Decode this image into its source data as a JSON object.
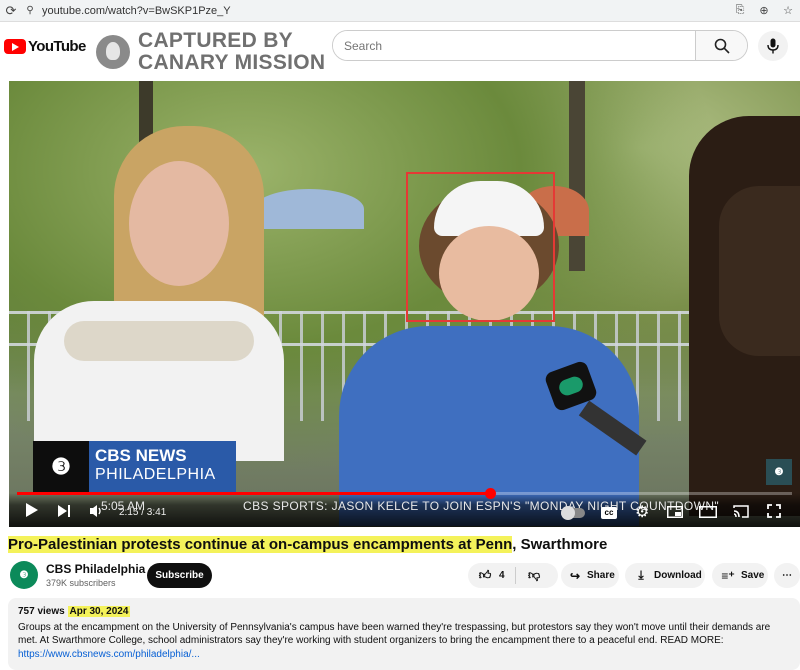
{
  "browser": {
    "url": "youtube.com/watch?v=BwSKP1Pze_Y"
  },
  "header": {
    "logo_text": "YouTube",
    "watermark_line1": "CAPTURED BY",
    "watermark_line2": "CANARY MISSION",
    "search_placeholder": "Search"
  },
  "player": {
    "lower_third_logo": "❸",
    "lower_third_line1": "CBS NEWS",
    "lower_third_line2": "PHILADELPHIA",
    "ticker_time": "5:05 AM",
    "ticker_headline": "CBS SPORTS: JASON KELCE TO JOIN ESPN'S \"MONDAY NIGHT COUNTDOWN\"",
    "current_time": "2:15 / 3:41",
    "progress_fraction": 0.61
  },
  "video": {
    "title_highlighted": "Pro-Palestinian protests continue at on-campus encampments at Penn",
    "title_rest": ", Swarthmore"
  },
  "channel": {
    "name": "CBS Philadelphia",
    "subscribers": "379K subscribers",
    "subscribe_label": "Subscribe"
  },
  "actions": {
    "likes": "4",
    "share_label": "Share",
    "download_label": "Download",
    "save_label": "Save"
  },
  "description": {
    "views": "757 views",
    "date": "Apr 30, 2024",
    "text": "Groups at the encampment on the University of Pennsylvania's campus have been warned they're trespassing, but protestors say they won't move until their demands are met. At Swarthmore College, school administrators say they're working with student organizers to bring the encampment there to a peaceful end. READ MORE:",
    "link": "https://www.cbsnews.com/philadelphia/..."
  },
  "colors": {
    "brand_red": "#ff0000",
    "highlight": "#f4f25a",
    "link": "#065fd4",
    "cbs_blue": "#2a5aa8"
  }
}
